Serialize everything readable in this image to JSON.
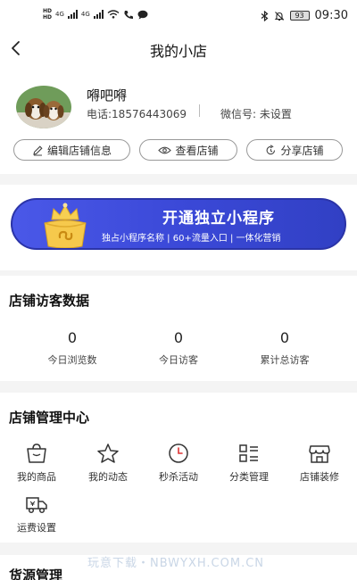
{
  "status_bar": {
    "left_hd": [
      "HD",
      "HD"
    ],
    "net": [
      "4G",
      "4G"
    ],
    "icons_left": [
      "signal-icon",
      "signal-icon",
      "wifi-icon",
      "call-icon",
      "message-icon"
    ],
    "icons_right": [
      "bluetooth-icon",
      "mute-icon"
    ],
    "battery": "93",
    "time": "09:30"
  },
  "header": {
    "title": "我的小店"
  },
  "store": {
    "name": "嘚吧嘚",
    "phone": "电话:18576443069",
    "wechat": "微信号: 未设置",
    "actions": [
      {
        "label": "编辑店铺信息",
        "icon": "edit-icon"
      },
      {
        "label": "查看店铺",
        "icon": "eye-icon"
      },
      {
        "label": "分享店铺",
        "icon": "share-icon"
      }
    ]
  },
  "banner": {
    "title": "开通独立小程序",
    "subtitle": "独占小程序名称 | 60+流量入口 | 一体化营销"
  },
  "visitors": {
    "title": "店铺访客数据",
    "stats": [
      {
        "value": "0",
        "label": "今日浏览数"
      },
      {
        "value": "0",
        "label": "今日访客"
      },
      {
        "value": "0",
        "label": "累计总访客"
      }
    ]
  },
  "management": {
    "title": "店铺管理中心",
    "items": [
      {
        "label": "我的商品",
        "icon": "bag-icon"
      },
      {
        "label": "我的动态",
        "icon": "star-icon"
      },
      {
        "label": "秒杀活动",
        "icon": "clock-icon"
      },
      {
        "label": "分类管理",
        "icon": "category-icon"
      },
      {
        "label": "店铺装修",
        "icon": "shop-icon"
      },
      {
        "label": "运费设置",
        "icon": "truck-icon"
      }
    ]
  },
  "bottom": {
    "title": "货源管理"
  },
  "watermark": "玩意下载・NBWYXH.COM.CN",
  "colors": {
    "banner": "#3b49d8",
    "crown": "#f4c84a"
  }
}
